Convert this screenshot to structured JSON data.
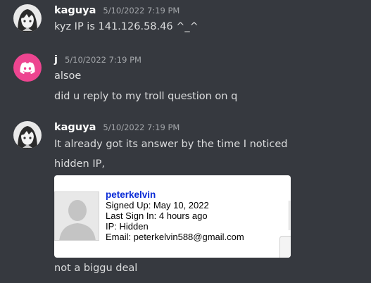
{
  "messages": [
    {
      "username": "kaguya",
      "timestamp": "5/10/2022 7:19 PM",
      "lines": [
        "kyz IP is 141.126.58.46 ^_^"
      ]
    },
    {
      "username": "j",
      "timestamp": "5/10/2022 7:19 PM",
      "lines": [
        "alsoe",
        "did u reply to my troll question on q"
      ]
    },
    {
      "username": "kaguya",
      "timestamp": "5/10/2022 7:19 PM",
      "lines": [
        "It already got its answer by the time I noticed",
        "hidden IP,"
      ],
      "embed": {
        "name": "peterkelvin",
        "signed_up": "Signed Up: May 10, 2022",
        "last_sign_in": "Last Sign In: 4 hours ago",
        "ip": "IP: Hidden",
        "email": "Email: peterkelvin588@gmail.com"
      },
      "after_embed": "not a biggu deal"
    }
  ],
  "colors": {
    "background": "#36393f",
    "username": "#ffffff",
    "timestamp": "#a3a6aa",
    "text": "#dcddde",
    "discord_avatar": "#ed4590",
    "profile_link": "#0a2bd6"
  },
  "icons": [
    "anime-avatar-icon",
    "discord-logo-icon",
    "default-profile-photo-icon"
  ]
}
